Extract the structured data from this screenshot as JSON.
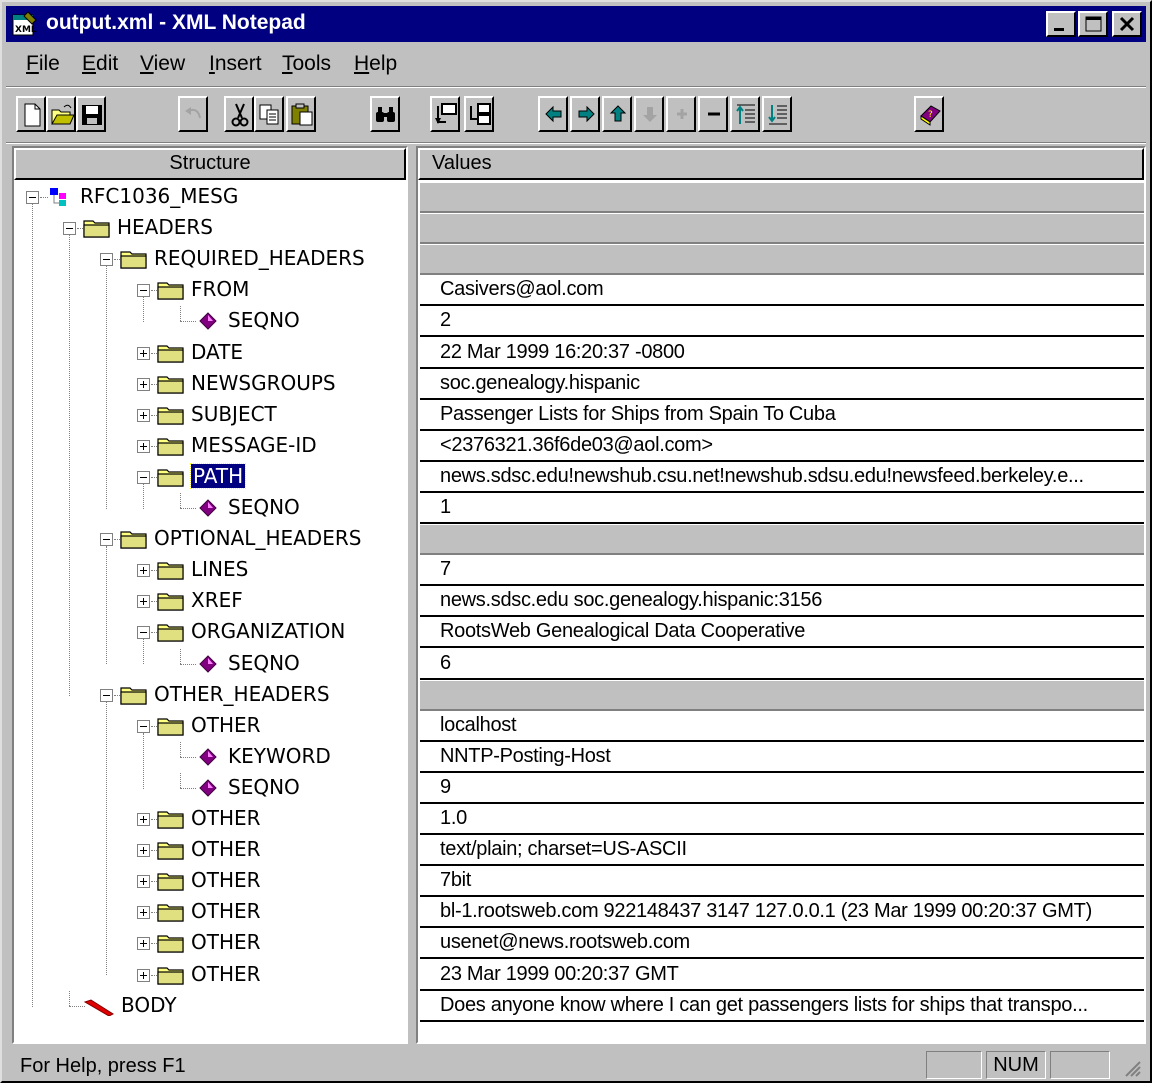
{
  "window": {
    "title": "output.xml - XML Notepad",
    "app_icon": "xml-notepad-icon"
  },
  "menu": [
    {
      "label": "File",
      "accel": "F",
      "rest": "ile"
    },
    {
      "label": "Edit",
      "accel": "E",
      "rest": "dit"
    },
    {
      "label": "View",
      "accel": "V",
      "rest": "iew"
    },
    {
      "label": "Insert",
      "accel": "I",
      "rest": "nsert"
    },
    {
      "label": "Tools",
      "accel": "T",
      "rest": "ools"
    },
    {
      "label": "Help",
      "accel": "H",
      "rest": "elp"
    }
  ],
  "toolbar": {
    "buttons": [
      "new-icon",
      "open-icon",
      "save-icon",
      "undo-icon",
      "cut-icon",
      "copy-icon",
      "paste-icon",
      "find-icon",
      "insert-element-icon",
      "insert-child-icon",
      "move-left-icon",
      "move-right-icon",
      "move-up-icon",
      "move-down-icon",
      "expand-icon",
      "collapse-icon",
      "expand-all-icon",
      "collapse-all-icon",
      "help-book-icon"
    ]
  },
  "structure": {
    "header": "Structure",
    "rows": [
      {
        "label": "RFC1036_MESG",
        "type": "root",
        "exp": "minus"
      },
      {
        "label": "HEADERS",
        "type": "folder",
        "exp": "minus"
      },
      {
        "label": "REQUIRED_HEADERS",
        "type": "folder",
        "exp": "minus"
      },
      {
        "label": "FROM",
        "type": "folder",
        "exp": "minus"
      },
      {
        "label": "SEQNO",
        "type": "attribute",
        "exp": ""
      },
      {
        "label": "DATE",
        "type": "folder",
        "exp": "plus"
      },
      {
        "label": "NEWSGROUPS",
        "type": "folder",
        "exp": "plus"
      },
      {
        "label": "SUBJECT",
        "type": "folder",
        "exp": "plus"
      },
      {
        "label": "MESSAGE-ID",
        "type": "folder",
        "exp": "plus"
      },
      {
        "label": "PATH",
        "type": "folder",
        "exp": "minus",
        "selected": true
      },
      {
        "label": "SEQNO",
        "type": "attribute",
        "exp": ""
      },
      {
        "label": "OPTIONAL_HEADERS",
        "type": "folder",
        "exp": "minus"
      },
      {
        "label": "LINES",
        "type": "folder",
        "exp": "plus"
      },
      {
        "label": "XREF",
        "type": "folder",
        "exp": "plus"
      },
      {
        "label": "ORGANIZATION",
        "type": "folder",
        "exp": "minus"
      },
      {
        "label": "SEQNO",
        "type": "attribute",
        "exp": ""
      },
      {
        "label": "OTHER_HEADERS",
        "type": "folder",
        "exp": "minus"
      },
      {
        "label": "OTHER",
        "type": "folder",
        "exp": "minus"
      },
      {
        "label": "KEYWORD",
        "type": "attribute",
        "exp": ""
      },
      {
        "label": "SEQNO",
        "type": "attribute",
        "exp": ""
      },
      {
        "label": "OTHER",
        "type": "folder",
        "exp": "plus"
      },
      {
        "label": "OTHER",
        "type": "folder",
        "exp": "plus"
      },
      {
        "label": "OTHER",
        "type": "folder",
        "exp": "plus"
      },
      {
        "label": "OTHER",
        "type": "folder",
        "exp": "plus"
      },
      {
        "label": "OTHER",
        "type": "folder",
        "exp": "plus"
      },
      {
        "label": "OTHER",
        "type": "folder",
        "exp": "plus"
      },
      {
        "label": "BODY",
        "type": "text",
        "exp": ""
      }
    ]
  },
  "values": {
    "header": "Values",
    "rows": [
      {
        "text": "",
        "grey": true
      },
      {
        "text": "",
        "grey": true
      },
      {
        "text": "",
        "grey": true
      },
      {
        "text": "Casivers@aol.com",
        "grey": false
      },
      {
        "text": "2",
        "grey": false
      },
      {
        "text": "22 Mar 1999 16:20:37 -0800",
        "grey": false
      },
      {
        "text": "soc.genealogy.hispanic",
        "grey": false
      },
      {
        "text": "Passenger Lists for Ships from Spain To Cuba",
        "grey": false
      },
      {
        "text": "<2376321.36f6de03@aol.com>",
        "grey": false
      },
      {
        "text": "news.sdsc.edu!newshub.csu.net!newshub.sdsu.edu!newsfeed.berkeley.e...",
        "grey": false
      },
      {
        "text": "1",
        "grey": false
      },
      {
        "text": "",
        "grey": true
      },
      {
        "text": "7",
        "grey": false
      },
      {
        "text": "news.sdsc.edu soc.genealogy.hispanic:3156",
        "grey": false
      },
      {
        "text": "RootsWeb Genealogical Data Cooperative",
        "grey": false
      },
      {
        "text": "6",
        "grey": false
      },
      {
        "text": "",
        "grey": true
      },
      {
        "text": "localhost",
        "grey": false
      },
      {
        "text": "NNTP-Posting-Host",
        "grey": false
      },
      {
        "text": "9",
        "grey": false
      },
      {
        "text": "1.0",
        "grey": false
      },
      {
        "text": "text/plain; charset=US-ASCII",
        "grey": false
      },
      {
        "text": "7bit",
        "grey": false
      },
      {
        "text": "bl-1.rootsweb.com 922148437 3147 127.0.0.1 (23 Mar 1999 00:20:37 GMT)",
        "grey": false
      },
      {
        "text": "usenet@news.rootsweb.com",
        "grey": false
      },
      {
        "text": "23 Mar 1999 00:20:37 GMT",
        "grey": false
      },
      {
        "text": "Does anyone know where I can get passengers lists for ships that transpo...",
        "grey": false
      }
    ]
  },
  "status": {
    "help_text": "For Help, press F1",
    "num": "NUM"
  }
}
